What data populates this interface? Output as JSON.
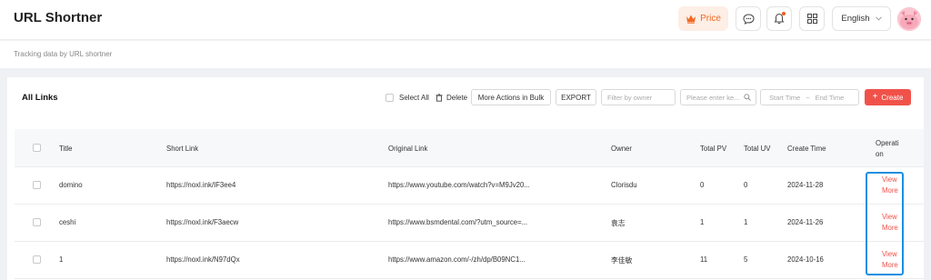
{
  "header": {
    "title": "URL Shortner",
    "price_label": "Price",
    "language": "English"
  },
  "subheader": {
    "text": "Tracking data by URL shortner"
  },
  "card": {
    "title": "All Links",
    "toolbar": {
      "select_all": "Select All",
      "delete": "Delete",
      "more_actions": "More Actions in Bulk",
      "export": "EXPORT",
      "owner_filter_placeholder": "Filter by owner",
      "keyword_placeholder": "Please enter ke...",
      "start_time": "Start Time",
      "date_separator": "~",
      "end_time": "End Time",
      "create": "Create"
    }
  },
  "table": {
    "columns": [
      "Title",
      "Short Link",
      "Original Link",
      "Owner",
      "Total PV",
      "Total UV",
      "Create Time",
      "Operation"
    ],
    "operation_header_lines": [
      "Operati",
      "on"
    ],
    "rows": [
      {
        "title": "domino",
        "short_link": "https://noxl.ink/IF3ee4",
        "original_link": "https://www.youtube.com/watch?v=M9Jv20...",
        "owner": "Clorisdu",
        "pv": "0",
        "uv": "0",
        "create_time": "2024-11-28",
        "op1": "View",
        "op2": "More"
      },
      {
        "title": "ceshi",
        "short_link": "https://noxl.ink/F3aecw",
        "original_link": "https://www.bsmdental.com/?utm_source=...",
        "owner": "袁志",
        "pv": "1",
        "uv": "1",
        "create_time": "2024-11-26",
        "op1": "View",
        "op2": "More"
      },
      {
        "title": "1",
        "short_link": "https://noxl.ink/N97dQx",
        "original_link": "https://www.amazon.com/-/zh/dp/B09NC1...",
        "owner": "李佳敏",
        "pv": "11",
        "uv": "5",
        "create_time": "2024-10-16",
        "op1": "View",
        "op2": "More"
      }
    ]
  },
  "colors": {
    "accent": "#f0524a",
    "price": "#f06a24",
    "highlight": "#1a8fe0"
  },
  "icons": [
    "crown-icon",
    "chat-icon",
    "bell-icon",
    "grid-icon",
    "chevron-down-icon",
    "trash-icon",
    "search-icon",
    "plus-icon",
    "avatar"
  ]
}
